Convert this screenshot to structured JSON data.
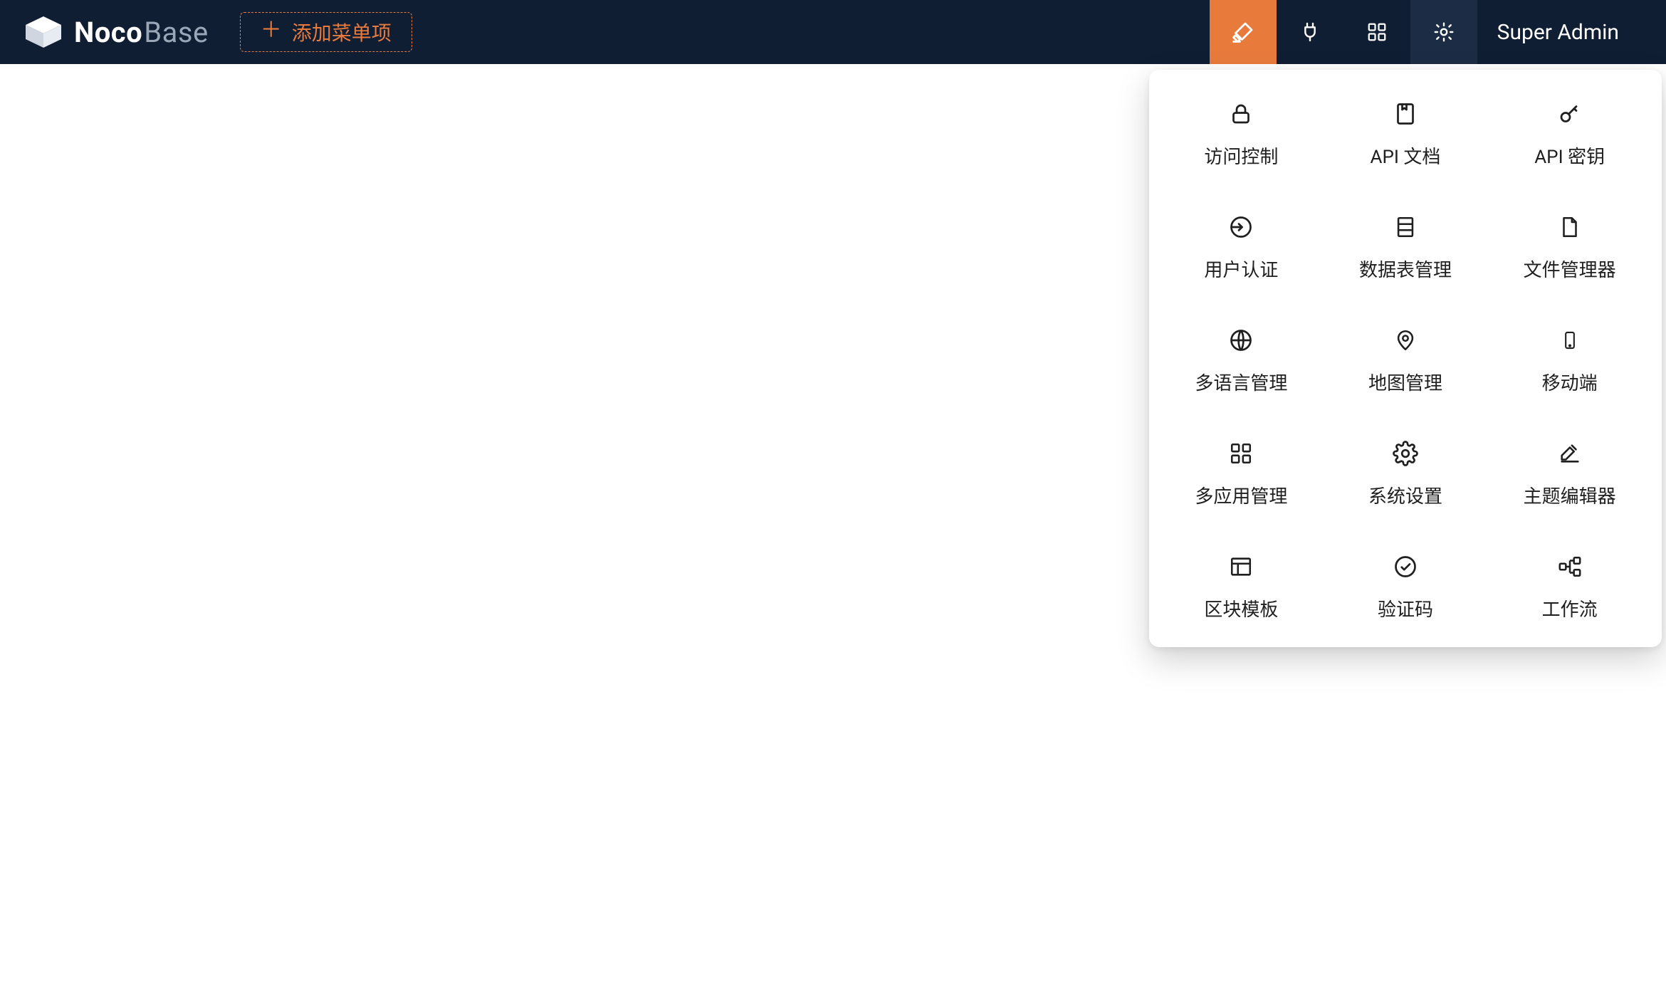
{
  "brand": {
    "strong": "Noco",
    "light": "Base"
  },
  "header": {
    "add_menu_label": "添加菜单项",
    "user_label": "Super Admin"
  },
  "settings_panel": {
    "items": [
      {
        "icon": "lock-icon",
        "label": "访问控制"
      },
      {
        "icon": "book-icon",
        "label": "API 文档"
      },
      {
        "icon": "key-icon",
        "label": "API 密钥"
      },
      {
        "icon": "login-icon",
        "label": "用户认证"
      },
      {
        "icon": "table-icon",
        "label": "数据表管理"
      },
      {
        "icon": "file-icon",
        "label": "文件管理器"
      },
      {
        "icon": "globe-icon",
        "label": "多语言管理"
      },
      {
        "icon": "map-pin-icon",
        "label": "地图管理"
      },
      {
        "icon": "mobile-icon",
        "label": "移动端"
      },
      {
        "icon": "apps-icon",
        "label": "多应用管理"
      },
      {
        "icon": "gear-icon",
        "label": "系统设置"
      },
      {
        "icon": "paint-icon",
        "label": "主题编辑器"
      },
      {
        "icon": "layout-icon",
        "label": "区块模板"
      },
      {
        "icon": "check-circle-icon",
        "label": "验证码"
      },
      {
        "icon": "workflow-icon",
        "label": "工作流"
      }
    ]
  }
}
